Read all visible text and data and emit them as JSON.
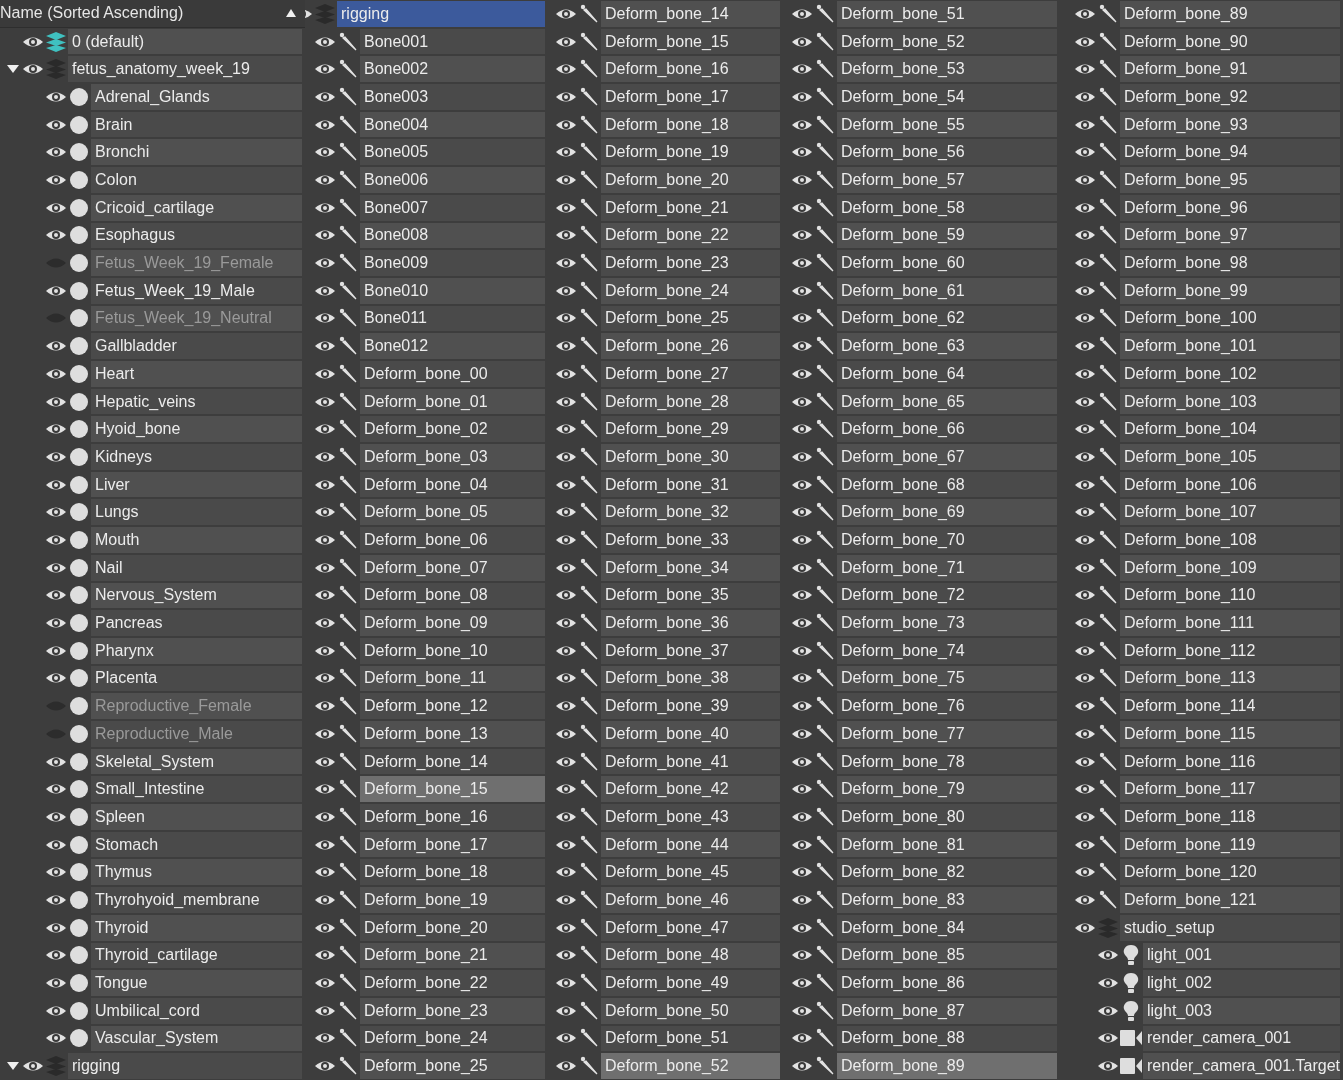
{
  "panels": [
    {
      "header": {
        "label": "Name (Sorted Ascending)"
      },
      "items": [
        {
          "name": "0 (default)",
          "kind": "layer",
          "current": true,
          "visible": true,
          "selected": false
        },
        {
          "name": "fetus_anatomy_week_19",
          "kind": "layer",
          "current": false,
          "visible": true,
          "selected": false,
          "expanded": true,
          "children": [
            {
              "name": "Adrenal_Glands",
              "kind": "geometry",
              "visible": true,
              "selected": false
            },
            {
              "name": "Brain",
              "kind": "geometry",
              "visible": true,
              "selected": false
            },
            {
              "name": "Bronchi",
              "kind": "geometry",
              "visible": true,
              "selected": false
            },
            {
              "name": "Colon",
              "kind": "geometry",
              "visible": true,
              "selected": false
            },
            {
              "name": "Cricoid_cartilage",
              "kind": "geometry",
              "visible": true,
              "selected": false
            },
            {
              "name": "Esophagus",
              "kind": "geometry",
              "visible": true,
              "selected": false
            },
            {
              "name": "Fetus_Week_19_Female",
              "kind": "geometry",
              "visible": false,
              "selected": false
            },
            {
              "name": "Fetus_Week_19_Male",
              "kind": "geometry",
              "visible": true,
              "selected": false
            },
            {
              "name": "Fetus_Week_19_Neutral",
              "kind": "geometry",
              "visible": false,
              "selected": false
            },
            {
              "name": "Gallbladder",
              "kind": "geometry",
              "visible": true,
              "selected": false
            },
            {
              "name": "Heart",
              "kind": "geometry",
              "visible": true,
              "selected": false
            },
            {
              "name": "Hepatic_veins",
              "kind": "geometry",
              "visible": true,
              "selected": false
            },
            {
              "name": "Hyoid_bone",
              "kind": "geometry",
              "visible": true,
              "selected": false
            },
            {
              "name": "Kidneys",
              "kind": "geometry",
              "visible": true,
              "selected": false
            },
            {
              "name": "Liver",
              "kind": "geometry",
              "visible": true,
              "selected": false
            },
            {
              "name": "Lungs",
              "kind": "geometry",
              "visible": true,
              "selected": false
            },
            {
              "name": "Mouth",
              "kind": "geometry",
              "visible": true,
              "selected": false
            },
            {
              "name": "Nail",
              "kind": "geometry",
              "visible": true,
              "selected": false
            },
            {
              "name": "Nervous_System",
              "kind": "geometry",
              "visible": true,
              "selected": false
            },
            {
              "name": "Pancreas",
              "kind": "geometry",
              "visible": true,
              "selected": false
            },
            {
              "name": "Pharynx",
              "kind": "geometry",
              "visible": true,
              "selected": false
            },
            {
              "name": "Placenta",
              "kind": "geometry",
              "visible": true,
              "selected": false
            },
            {
              "name": "Reproductive_Female",
              "kind": "geometry",
              "visible": false,
              "selected": false
            },
            {
              "name": "Reproductive_Male",
              "kind": "geometry",
              "visible": false,
              "selected": false
            },
            {
              "name": "Skeletal_System",
              "kind": "geometry",
              "visible": true,
              "selected": false
            },
            {
              "name": "Small_Intestine",
              "kind": "geometry",
              "visible": true,
              "selected": false
            },
            {
              "name": "Spleen",
              "kind": "geometry",
              "visible": true,
              "selected": false
            },
            {
              "name": "Stomach",
              "kind": "geometry",
              "visible": true,
              "selected": false
            },
            {
              "name": "Thymus",
              "kind": "geometry",
              "visible": true,
              "selected": false
            },
            {
              "name": "Thyrohyoid_membrane",
              "kind": "geometry",
              "visible": true,
              "selected": false
            },
            {
              "name": "Thyroid",
              "kind": "geometry",
              "visible": true,
              "selected": false
            },
            {
              "name": "Thyroid_cartilage",
              "kind": "geometry",
              "visible": true,
              "selected": false
            },
            {
              "name": "Tongue",
              "kind": "geometry",
              "visible": true,
              "selected": false
            },
            {
              "name": "Umbilical_cord",
              "kind": "geometry",
              "visible": true,
              "selected": false
            },
            {
              "name": "Vascular_System",
              "kind": "geometry",
              "visible": true,
              "selected": false
            }
          ]
        },
        {
          "name": "rigging",
          "kind": "layer",
          "current": false,
          "visible": true,
          "selected": false,
          "expanded": true
        }
      ]
    },
    {
      "items": [
        {
          "name": "rigging",
          "kind": "layer",
          "current": false,
          "visible": true,
          "selected": true,
          "children": [
            {
              "name": "Bone001",
              "kind": "bone",
              "visible": true,
              "selected": false
            },
            {
              "name": "Bone002",
              "kind": "bone",
              "visible": true,
              "selected": false
            },
            {
              "name": "Bone003",
              "kind": "bone",
              "visible": true,
              "selected": false
            },
            {
              "name": "Bone004",
              "kind": "bone",
              "visible": true,
              "selected": false
            },
            {
              "name": "Bone005",
              "kind": "bone",
              "visible": true,
              "selected": false
            },
            {
              "name": "Bone006",
              "kind": "bone",
              "visible": true,
              "selected": false
            },
            {
              "name": "Bone007",
              "kind": "bone",
              "visible": true,
              "selected": false
            },
            {
              "name": "Bone008",
              "kind": "bone",
              "visible": true,
              "selected": false
            },
            {
              "name": "Bone009",
              "kind": "bone",
              "visible": true,
              "selected": false
            },
            {
              "name": "Bone010",
              "kind": "bone",
              "visible": true,
              "selected": false
            },
            {
              "name": "Bone011",
              "kind": "bone",
              "visible": true,
              "selected": false
            },
            {
              "name": "Bone012",
              "kind": "bone",
              "visible": true,
              "selected": false
            },
            {
              "name": "Deform_bone_00",
              "kind": "bone",
              "visible": true,
              "selected": false
            },
            {
              "name": "Deform_bone_01",
              "kind": "bone",
              "visible": true,
              "selected": false
            },
            {
              "name": "Deform_bone_02",
              "kind": "bone",
              "visible": true,
              "selected": false
            },
            {
              "name": "Deform_bone_03",
              "kind": "bone",
              "visible": true,
              "selected": false
            },
            {
              "name": "Deform_bone_04",
              "kind": "bone",
              "visible": true,
              "selected": false
            },
            {
              "name": "Deform_bone_05",
              "kind": "bone",
              "visible": true,
              "selected": false
            },
            {
              "name": "Deform_bone_06",
              "kind": "bone",
              "visible": true,
              "selected": false
            },
            {
              "name": "Deform_bone_07",
              "kind": "bone",
              "visible": true,
              "selected": false
            },
            {
              "name": "Deform_bone_08",
              "kind": "bone",
              "visible": true,
              "selected": false
            },
            {
              "name": "Deform_bone_09",
              "kind": "bone",
              "visible": true,
              "selected": false
            },
            {
              "name": "Deform_bone_10",
              "kind": "bone",
              "visible": true,
              "selected": false
            },
            {
              "name": "Deform_bone_11",
              "kind": "bone",
              "visible": true,
              "selected": false
            },
            {
              "name": "Deform_bone_12",
              "kind": "bone",
              "visible": true,
              "selected": false
            },
            {
              "name": "Deform_bone_13",
              "kind": "bone",
              "visible": true,
              "selected": false
            },
            {
              "name": "Deform_bone_14",
              "kind": "bone",
              "visible": true,
              "selected": false
            },
            {
              "name": "Deform_bone_15",
              "kind": "bone",
              "visible": true,
              "selected": true
            },
            {
              "name": "Deform_bone_16",
              "kind": "bone",
              "visible": true,
              "selected": false
            },
            {
              "name": "Deform_bone_17",
              "kind": "bone",
              "visible": true,
              "selected": false
            },
            {
              "name": "Deform_bone_18",
              "kind": "bone",
              "visible": true,
              "selected": false
            },
            {
              "name": "Deform_bone_19",
              "kind": "bone",
              "visible": true,
              "selected": false
            },
            {
              "name": "Deform_bone_20",
              "kind": "bone",
              "visible": true,
              "selected": false
            },
            {
              "name": "Deform_bone_21",
              "kind": "bone",
              "visible": true,
              "selected": false
            },
            {
              "name": "Deform_bone_22",
              "kind": "bone",
              "visible": true,
              "selected": false
            },
            {
              "name": "Deform_bone_23",
              "kind": "bone",
              "visible": true,
              "selected": false
            },
            {
              "name": "Deform_bone_24",
              "kind": "bone",
              "visible": true,
              "selected": false
            },
            {
              "name": "Deform_bone_25",
              "kind": "bone",
              "visible": true,
              "selected": false
            }
          ]
        }
      ]
    },
    {
      "items": [
        {
          "name": "Deform_bone_14",
          "kind": "bone",
          "visible": true,
          "selected": false
        },
        {
          "name": "Deform_bone_15",
          "kind": "bone",
          "visible": true,
          "selected": false
        },
        {
          "name": "Deform_bone_16",
          "kind": "bone",
          "visible": true,
          "selected": false
        },
        {
          "name": "Deform_bone_17",
          "kind": "bone",
          "visible": true,
          "selected": false
        },
        {
          "name": "Deform_bone_18",
          "kind": "bone",
          "visible": true,
          "selected": false
        },
        {
          "name": "Deform_bone_19",
          "kind": "bone",
          "visible": true,
          "selected": false
        },
        {
          "name": "Deform_bone_20",
          "kind": "bone",
          "visible": true,
          "selected": false
        },
        {
          "name": "Deform_bone_21",
          "kind": "bone",
          "visible": true,
          "selected": false
        },
        {
          "name": "Deform_bone_22",
          "kind": "bone",
          "visible": true,
          "selected": false
        },
        {
          "name": "Deform_bone_23",
          "kind": "bone",
          "visible": true,
          "selected": false
        },
        {
          "name": "Deform_bone_24",
          "kind": "bone",
          "visible": true,
          "selected": false
        },
        {
          "name": "Deform_bone_25",
          "kind": "bone",
          "visible": true,
          "selected": false
        },
        {
          "name": "Deform_bone_26",
          "kind": "bone",
          "visible": true,
          "selected": false
        },
        {
          "name": "Deform_bone_27",
          "kind": "bone",
          "visible": true,
          "selected": false
        },
        {
          "name": "Deform_bone_28",
          "kind": "bone",
          "visible": true,
          "selected": false
        },
        {
          "name": "Deform_bone_29",
          "kind": "bone",
          "visible": true,
          "selected": false
        },
        {
          "name": "Deform_bone_30",
          "kind": "bone",
          "visible": true,
          "selected": false
        },
        {
          "name": "Deform_bone_31",
          "kind": "bone",
          "visible": true,
          "selected": false
        },
        {
          "name": "Deform_bone_32",
          "kind": "bone",
          "visible": true,
          "selected": false
        },
        {
          "name": "Deform_bone_33",
          "kind": "bone",
          "visible": true,
          "selected": false
        },
        {
          "name": "Deform_bone_34",
          "kind": "bone",
          "visible": true,
          "selected": false
        },
        {
          "name": "Deform_bone_35",
          "kind": "bone",
          "visible": true,
          "selected": false
        },
        {
          "name": "Deform_bone_36",
          "kind": "bone",
          "visible": true,
          "selected": false
        },
        {
          "name": "Deform_bone_37",
          "kind": "bone",
          "visible": true,
          "selected": false
        },
        {
          "name": "Deform_bone_38",
          "kind": "bone",
          "visible": true,
          "selected": false
        },
        {
          "name": "Deform_bone_39",
          "kind": "bone",
          "visible": true,
          "selected": false
        },
        {
          "name": "Deform_bone_40",
          "kind": "bone",
          "visible": true,
          "selected": false
        },
        {
          "name": "Deform_bone_41",
          "kind": "bone",
          "visible": true,
          "selected": false
        },
        {
          "name": "Deform_bone_42",
          "kind": "bone",
          "visible": true,
          "selected": false
        },
        {
          "name": "Deform_bone_43",
          "kind": "bone",
          "visible": true,
          "selected": false
        },
        {
          "name": "Deform_bone_44",
          "kind": "bone",
          "visible": true,
          "selected": false
        },
        {
          "name": "Deform_bone_45",
          "kind": "bone",
          "visible": true,
          "selected": false
        },
        {
          "name": "Deform_bone_46",
          "kind": "bone",
          "visible": true,
          "selected": false
        },
        {
          "name": "Deform_bone_47",
          "kind": "bone",
          "visible": true,
          "selected": false
        },
        {
          "name": "Deform_bone_48",
          "kind": "bone",
          "visible": true,
          "selected": false
        },
        {
          "name": "Deform_bone_49",
          "kind": "bone",
          "visible": true,
          "selected": false
        },
        {
          "name": "Deform_bone_50",
          "kind": "bone",
          "visible": true,
          "selected": false
        },
        {
          "name": "Deform_bone_51",
          "kind": "bone",
          "visible": true,
          "selected": false
        },
        {
          "name": "Deform_bone_52",
          "kind": "bone",
          "visible": true,
          "selected": true
        }
      ]
    },
    {
      "items": [
        {
          "name": "Deform_bone_51",
          "kind": "bone",
          "visible": true,
          "selected": false
        },
        {
          "name": "Deform_bone_52",
          "kind": "bone",
          "visible": true,
          "selected": false
        },
        {
          "name": "Deform_bone_53",
          "kind": "bone",
          "visible": true,
          "selected": false
        },
        {
          "name": "Deform_bone_54",
          "kind": "bone",
          "visible": true,
          "selected": false
        },
        {
          "name": "Deform_bone_55",
          "kind": "bone",
          "visible": true,
          "selected": false
        },
        {
          "name": "Deform_bone_56",
          "kind": "bone",
          "visible": true,
          "selected": false
        },
        {
          "name": "Deform_bone_57",
          "kind": "bone",
          "visible": true,
          "selected": false
        },
        {
          "name": "Deform_bone_58",
          "kind": "bone",
          "visible": true,
          "selected": false
        },
        {
          "name": "Deform_bone_59",
          "kind": "bone",
          "visible": true,
          "selected": false
        },
        {
          "name": "Deform_bone_60",
          "kind": "bone",
          "visible": true,
          "selected": false
        },
        {
          "name": "Deform_bone_61",
          "kind": "bone",
          "visible": true,
          "selected": false
        },
        {
          "name": "Deform_bone_62",
          "kind": "bone",
          "visible": true,
          "selected": false
        },
        {
          "name": "Deform_bone_63",
          "kind": "bone",
          "visible": true,
          "selected": false
        },
        {
          "name": "Deform_bone_64",
          "kind": "bone",
          "visible": true,
          "selected": false
        },
        {
          "name": "Deform_bone_65",
          "kind": "bone",
          "visible": true,
          "selected": false
        },
        {
          "name": "Deform_bone_66",
          "kind": "bone",
          "visible": true,
          "selected": false
        },
        {
          "name": "Deform_bone_67",
          "kind": "bone",
          "visible": true,
          "selected": false
        },
        {
          "name": "Deform_bone_68",
          "kind": "bone",
          "visible": true,
          "selected": false
        },
        {
          "name": "Deform_bone_69",
          "kind": "bone",
          "visible": true,
          "selected": false
        },
        {
          "name": "Deform_bone_70",
          "kind": "bone",
          "visible": true,
          "selected": false
        },
        {
          "name": "Deform_bone_71",
          "kind": "bone",
          "visible": true,
          "selected": false
        },
        {
          "name": "Deform_bone_72",
          "kind": "bone",
          "visible": true,
          "selected": false
        },
        {
          "name": "Deform_bone_73",
          "kind": "bone",
          "visible": true,
          "selected": false
        },
        {
          "name": "Deform_bone_74",
          "kind": "bone",
          "visible": true,
          "selected": false
        },
        {
          "name": "Deform_bone_75",
          "kind": "bone",
          "visible": true,
          "selected": false
        },
        {
          "name": "Deform_bone_76",
          "kind": "bone",
          "visible": true,
          "selected": false
        },
        {
          "name": "Deform_bone_77",
          "kind": "bone",
          "visible": true,
          "selected": false
        },
        {
          "name": "Deform_bone_78",
          "kind": "bone",
          "visible": true,
          "selected": false
        },
        {
          "name": "Deform_bone_79",
          "kind": "bone",
          "visible": true,
          "selected": false
        },
        {
          "name": "Deform_bone_80",
          "kind": "bone",
          "visible": true,
          "selected": false
        },
        {
          "name": "Deform_bone_81",
          "kind": "bone",
          "visible": true,
          "selected": false
        },
        {
          "name": "Deform_bone_82",
          "kind": "bone",
          "visible": true,
          "selected": false
        },
        {
          "name": "Deform_bone_83",
          "kind": "bone",
          "visible": true,
          "selected": false
        },
        {
          "name": "Deform_bone_84",
          "kind": "bone",
          "visible": true,
          "selected": false
        },
        {
          "name": "Deform_bone_85",
          "kind": "bone",
          "visible": true,
          "selected": false
        },
        {
          "name": "Deform_bone_86",
          "kind": "bone",
          "visible": true,
          "selected": false
        },
        {
          "name": "Deform_bone_87",
          "kind": "bone",
          "visible": true,
          "selected": false
        },
        {
          "name": "Deform_bone_88",
          "kind": "bone",
          "visible": true,
          "selected": false
        },
        {
          "name": "Deform_bone_89",
          "kind": "bone",
          "visible": true,
          "selected": true
        }
      ]
    },
    {
      "items": [
        {
          "name": "Deform_bone_89",
          "kind": "bone",
          "visible": true,
          "selected": false
        },
        {
          "name": "Deform_bone_90",
          "kind": "bone",
          "visible": true,
          "selected": false
        },
        {
          "name": "Deform_bone_91",
          "kind": "bone",
          "visible": true,
          "selected": false
        },
        {
          "name": "Deform_bone_92",
          "kind": "bone",
          "visible": true,
          "selected": false
        },
        {
          "name": "Deform_bone_93",
          "kind": "bone",
          "visible": true,
          "selected": false
        },
        {
          "name": "Deform_bone_94",
          "kind": "bone",
          "visible": true,
          "selected": false
        },
        {
          "name": "Deform_bone_95",
          "kind": "bone",
          "visible": true,
          "selected": false
        },
        {
          "name": "Deform_bone_96",
          "kind": "bone",
          "visible": true,
          "selected": false
        },
        {
          "name": "Deform_bone_97",
          "kind": "bone",
          "visible": true,
          "selected": false
        },
        {
          "name": "Deform_bone_98",
          "kind": "bone",
          "visible": true,
          "selected": false
        },
        {
          "name": "Deform_bone_99",
          "kind": "bone",
          "visible": true,
          "selected": false
        },
        {
          "name": "Deform_bone_100",
          "kind": "bone",
          "visible": true,
          "selected": false
        },
        {
          "name": "Deform_bone_101",
          "kind": "bone",
          "visible": true,
          "selected": false
        },
        {
          "name": "Deform_bone_102",
          "kind": "bone",
          "visible": true,
          "selected": false
        },
        {
          "name": "Deform_bone_103",
          "kind": "bone",
          "visible": true,
          "selected": false
        },
        {
          "name": "Deform_bone_104",
          "kind": "bone",
          "visible": true,
          "selected": false
        },
        {
          "name": "Deform_bone_105",
          "kind": "bone",
          "visible": true,
          "selected": false
        },
        {
          "name": "Deform_bone_106",
          "kind": "bone",
          "visible": true,
          "selected": false
        },
        {
          "name": "Deform_bone_107",
          "kind": "bone",
          "visible": true,
          "selected": false
        },
        {
          "name": "Deform_bone_108",
          "kind": "bone",
          "visible": true,
          "selected": false
        },
        {
          "name": "Deform_bone_109",
          "kind": "bone",
          "visible": true,
          "selected": false
        },
        {
          "name": "Deform_bone_110",
          "kind": "bone",
          "visible": true,
          "selected": false
        },
        {
          "name": "Deform_bone_111",
          "kind": "bone",
          "visible": true,
          "selected": false
        },
        {
          "name": "Deform_bone_112",
          "kind": "bone",
          "visible": true,
          "selected": false
        },
        {
          "name": "Deform_bone_113",
          "kind": "bone",
          "visible": true,
          "selected": false
        },
        {
          "name": "Deform_bone_114",
          "kind": "bone",
          "visible": true,
          "selected": false
        },
        {
          "name": "Deform_bone_115",
          "kind": "bone",
          "visible": true,
          "selected": false
        },
        {
          "name": "Deform_bone_116",
          "kind": "bone",
          "visible": true,
          "selected": false
        },
        {
          "name": "Deform_bone_117",
          "kind": "bone",
          "visible": true,
          "selected": false
        },
        {
          "name": "Deform_bone_118",
          "kind": "bone",
          "visible": true,
          "selected": false
        },
        {
          "name": "Deform_bone_119",
          "kind": "bone",
          "visible": true,
          "selected": false
        },
        {
          "name": "Deform_bone_120",
          "kind": "bone",
          "visible": true,
          "selected": false
        },
        {
          "name": "Deform_bone_121",
          "kind": "bone",
          "visible": true,
          "selected": false
        },
        {
          "name": "studio_setup",
          "kind": "layer",
          "current": false,
          "visible": true,
          "selected": false,
          "children": [
            {
              "name": "light_001",
              "kind": "light",
              "visible": true,
              "selected": false
            },
            {
              "name": "light_002",
              "kind": "light",
              "visible": true,
              "selected": false
            },
            {
              "name": "light_003",
              "kind": "light",
              "visible": true,
              "selected": false
            },
            {
              "name": "render_camera_001",
              "kind": "camera",
              "visible": true,
              "selected": false
            },
            {
              "name": "render_camera_001.Target",
              "kind": "camera",
              "visible": true,
              "selected": false
            }
          ]
        }
      ]
    }
  ]
}
